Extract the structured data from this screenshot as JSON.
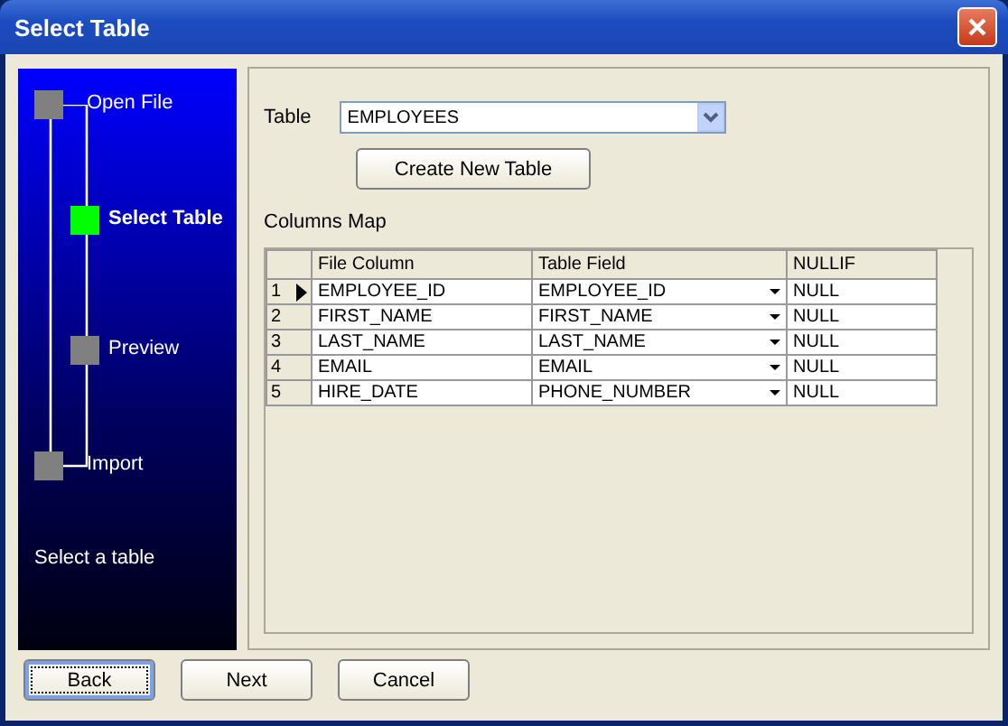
{
  "window": {
    "title": "Select Table"
  },
  "steps": [
    {
      "label": "Open File",
      "selected": false
    },
    {
      "label": "Select Table",
      "selected": true
    },
    {
      "label": "Preview",
      "selected": false
    },
    {
      "label": "Import",
      "selected": false
    }
  ],
  "hint": "Select a table",
  "table_field": {
    "label": "Table",
    "value": "EMPLOYEES"
  },
  "create_button": "Create New Table",
  "columns_map": {
    "label": "Columns Map",
    "columns": [
      "File Column",
      "Table Field",
      "NULLIF"
    ],
    "rows": [
      {
        "number": "1",
        "selected": true,
        "file_column": "EMPLOYEE_ID",
        "table_field": "EMPLOYEE_ID",
        "nullif": "NULL"
      },
      {
        "number": "2",
        "selected": false,
        "file_column": "FIRST_NAME",
        "table_field": "FIRST_NAME",
        "nullif": "NULL"
      },
      {
        "number": "3",
        "selected": false,
        "file_column": "LAST_NAME",
        "table_field": "LAST_NAME",
        "nullif": "NULL"
      },
      {
        "number": "4",
        "selected": false,
        "file_column": "EMAIL",
        "table_field": "EMAIL",
        "nullif": "NULL"
      },
      {
        "number": "5",
        "selected": false,
        "file_column": "HIRE_DATE",
        "table_field": "PHONE_NUMBER",
        "nullif": "NULL"
      }
    ]
  },
  "buttons": [
    {
      "label": "Back",
      "focused": true
    },
    {
      "label": "Next",
      "focused": false
    },
    {
      "label": "Cancel",
      "focused": false
    }
  ]
}
